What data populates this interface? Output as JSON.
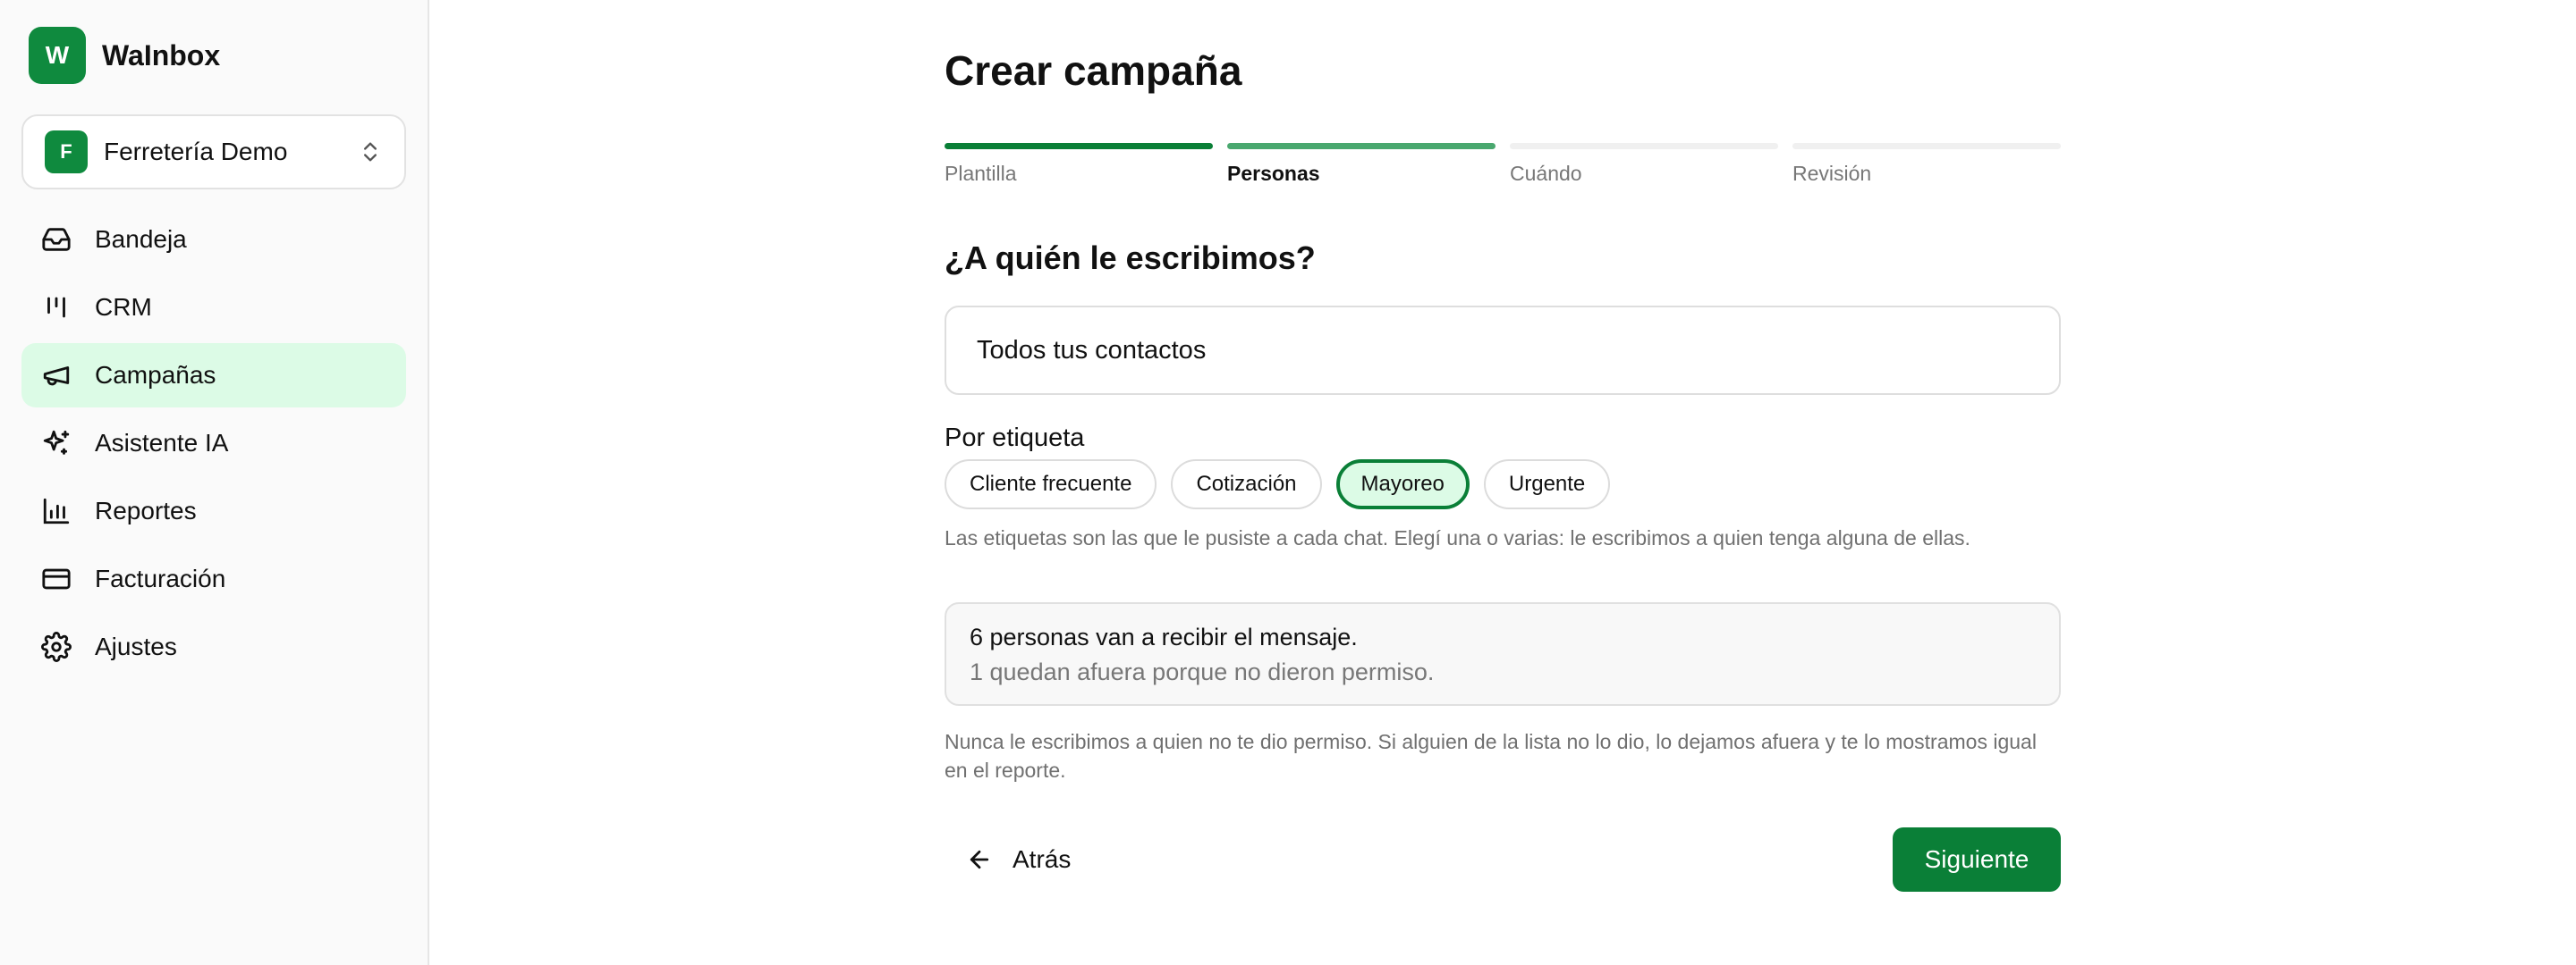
{
  "brand": {
    "logo_letter": "W",
    "name": "WaInbox",
    "color": "#0f8a3e"
  },
  "workspace": {
    "avatar_letter": "F",
    "name": "Ferretería Demo",
    "icon": "chevrons-up-down-icon"
  },
  "sidebar": {
    "items": [
      {
        "label": "Bandeja",
        "icon": "inbox-icon",
        "active": false
      },
      {
        "label": "CRM",
        "icon": "kanban-icon",
        "active": false
      },
      {
        "label": "Campañas",
        "icon": "megaphone-icon",
        "active": true
      },
      {
        "label": "Asistente IA",
        "icon": "sparkles-icon",
        "active": false
      },
      {
        "label": "Reportes",
        "icon": "bar-chart-icon",
        "active": false
      },
      {
        "label": "Facturación",
        "icon": "credit-card-icon",
        "active": false
      },
      {
        "label": "Ajustes",
        "icon": "gear-icon",
        "active": false
      }
    ]
  },
  "main": {
    "title": "Crear campaña",
    "steps": [
      {
        "label": "Plantilla",
        "state": "done"
      },
      {
        "label": "Personas",
        "state": "current"
      },
      {
        "label": "Cuándo",
        "state": "pending"
      },
      {
        "label": "Revisión",
        "state": "pending"
      }
    ],
    "question": "¿A quién le escribimos?",
    "all_contacts_option": "Todos tus contactos",
    "tag_heading": "Por etiqueta",
    "tags": [
      {
        "label": "Cliente frecuente",
        "selected": false
      },
      {
        "label": "Cotización",
        "selected": false
      },
      {
        "label": "Mayoreo",
        "selected": true
      },
      {
        "label": "Urgente",
        "selected": false
      }
    ],
    "tag_hint": "Las etiquetas son las que le pusiste a cada chat. Elegí una o varias: le escribimos a quien tenga alguna de ellas.",
    "summary": {
      "recipients": "6 personas van a recibir el mensaje.",
      "excluded": "1 quedan afuera porque no dieron permiso."
    },
    "consent_note": "Nunca le escribimos a quien no te dio permiso. Si alguien de la lista no lo dio, lo dejamos afuera y te lo mostramos igual en el reporte.",
    "back_label": "Atrás",
    "next_label": "Siguiente",
    "accent_color": "#0a7f37"
  }
}
